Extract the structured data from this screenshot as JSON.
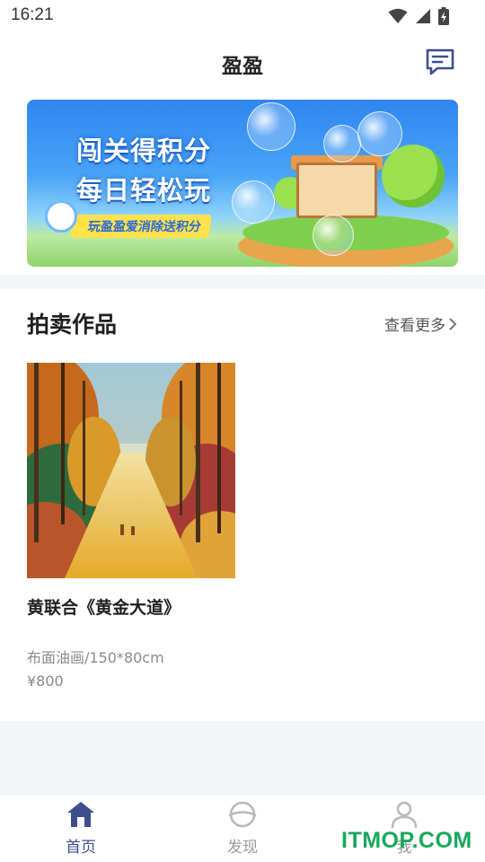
{
  "status_bar": {
    "time": "16:21",
    "icons": [
      "wifi-icon",
      "signal-icon",
      "battery-charging-icon"
    ]
  },
  "header": {
    "title": "盈盈",
    "message_icon": "message-icon"
  },
  "banner": {
    "title_line1": "闯关得积分",
    "title_line2": "每日轻松玩",
    "tag": "玩盈盈爱消除送积分"
  },
  "auction": {
    "title": "拍卖作品",
    "view_more": "查看更多",
    "items": [
      {
        "name": "黄联合《黄金大道》",
        "medium": "布面油画/150*80cm",
        "price": "¥800"
      }
    ]
  },
  "bottom_nav": {
    "items": [
      {
        "label": "首页",
        "icon": "home-icon",
        "active": true
      },
      {
        "label": "发现",
        "icon": "planet-icon",
        "active": false
      },
      {
        "label": "我",
        "icon": "user-icon",
        "active": false
      }
    ]
  },
  "watermark": "ITMOP.COM",
  "colors": {
    "accent": "#3c4f8c",
    "inactive": "#9a9a9a",
    "watermark": "#18a85c"
  }
}
